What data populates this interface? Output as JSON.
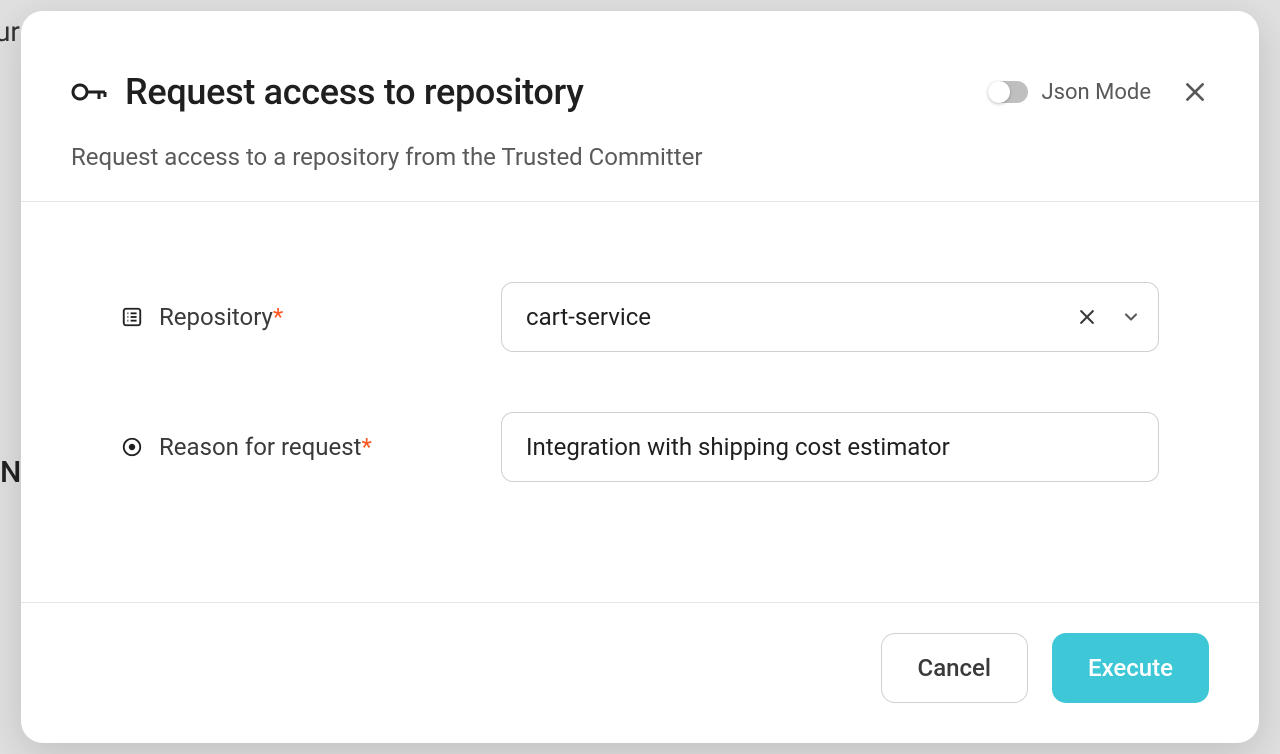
{
  "modal": {
    "title": "Request access to repository",
    "subtitle": "Request access to a repository from the Trusted Committer",
    "json_mode_label": "Json Mode"
  },
  "form": {
    "repository": {
      "label": "Repository",
      "value": "cart-service"
    },
    "reason": {
      "label": "Reason for request",
      "value": "Integration with shipping cost estimator"
    }
  },
  "footer": {
    "cancel_label": "Cancel",
    "execute_label": "Execute"
  },
  "backdrop": {
    "fragment_top": "ur",
    "fragment_mid": "N"
  }
}
